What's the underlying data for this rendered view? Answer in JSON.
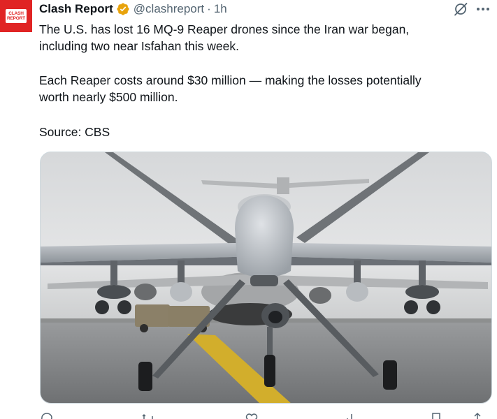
{
  "post": {
    "author": {
      "display_name": "Clash Report",
      "handle": "@clashreport",
      "verified": true,
      "avatar_text": [
        "CLASH",
        "REPORT"
      ],
      "avatar_color": "#e02424"
    },
    "separator": "·",
    "time": "1h",
    "text_lines": [
      "The U.S. has lost 16 MQ-9 Reaper drones since the Iran war began,",
      "including two near Isfahan this week.",
      "Each Reaper costs around $30 million — making the losses potentially",
      "worth nearly $500 million.",
      "Source: CBS"
    ],
    "media": {
      "kind": "photo",
      "subject": "mq9-reaper-drone-on-runway"
    }
  },
  "icons": {
    "verified": "verified-badge-icon",
    "grok": "grok-icon",
    "more": "more-icon"
  },
  "colors": {
    "text": "#0f1419",
    "secondary": "#536471",
    "verified_gold": "#e8a30c",
    "brand_red": "#e02424",
    "border": "#cfd9de"
  }
}
